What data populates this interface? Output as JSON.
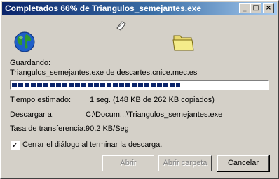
{
  "window": {
    "title": "Completados 66% de Triangulos_semejantes.exe",
    "controls": {
      "minimize": "_",
      "maximize": "□",
      "close": "×"
    }
  },
  "icons": {
    "source": "globe-icon",
    "transfer": "flying-paper-icon",
    "destination": "folder-icon"
  },
  "saving": {
    "label": "Guardando:",
    "value": "Triangulos_semejantes.exe de descartes.cnice.mec.es"
  },
  "progress": {
    "percent": 66,
    "color": "#0a246a"
  },
  "time": {
    "label": "Tiempo estimado:",
    "value": "1 seg. (148 KB de 262 KB copiados)"
  },
  "download_to": {
    "label": "Descargar a:",
    "value": "C:\\Docum...\\Triangulos_semejantes.exe"
  },
  "rate": {
    "label": "Tasa de transferencia:",
    "value": "90,2 KB/Seg"
  },
  "close_option": {
    "checked": true,
    "label": "Cerrar el diálogo al terminar la descarga."
  },
  "buttons": {
    "open": "Abrir",
    "open_folder": "Abrir carpeta",
    "cancel": "Cancelar"
  }
}
